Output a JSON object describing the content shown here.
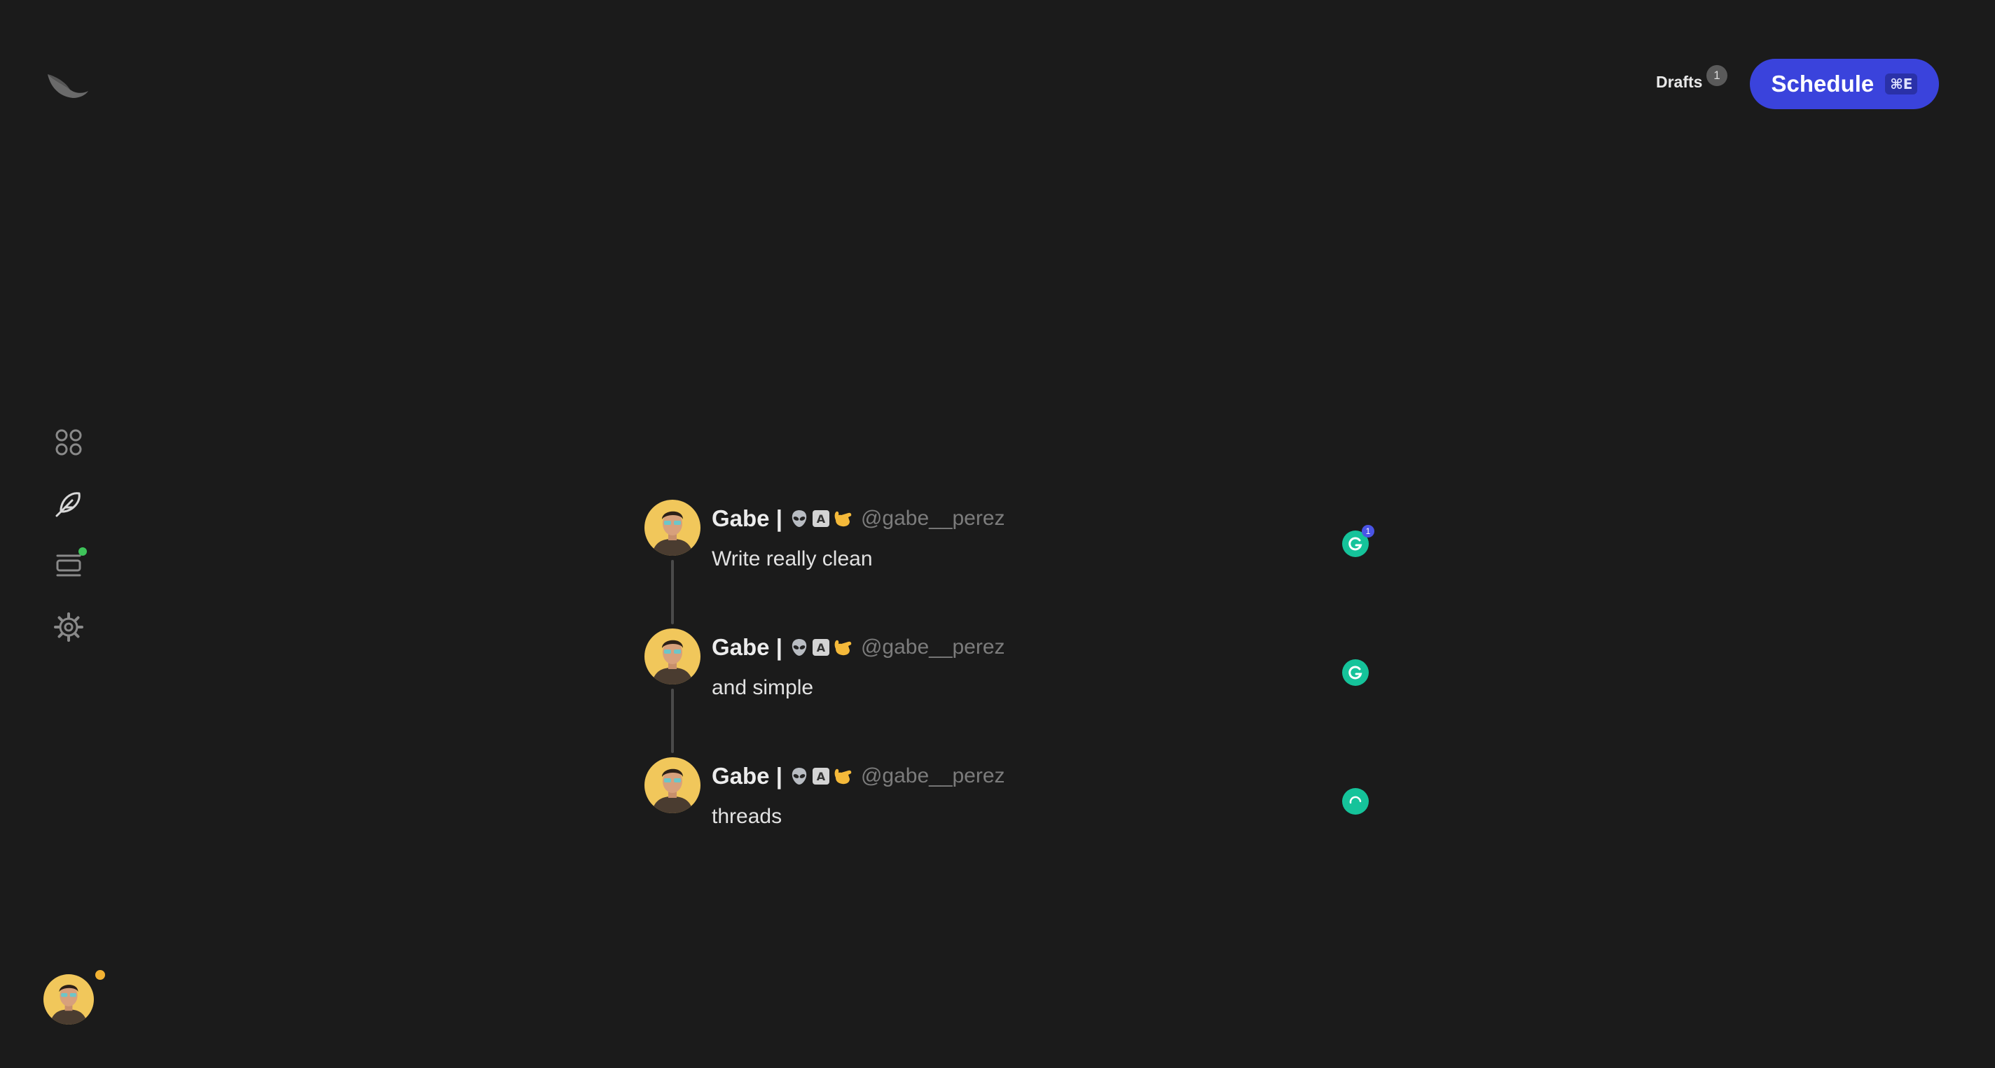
{
  "colors": {
    "background": "#1b1b1b",
    "accent": "#3a43dc",
    "online_dot": "#3ec45a",
    "status_dot": "#f2b233",
    "grammarly": "#15c39a"
  },
  "sidebar": {
    "logo_icon": "bird-wing-icon",
    "items": [
      {
        "id": "dashboard",
        "icon": "grid-icon"
      },
      {
        "id": "compose",
        "icon": "feather-icon"
      },
      {
        "id": "queue",
        "icon": "stack-icon",
        "has_notification": true
      },
      {
        "id": "settings",
        "icon": "gear-icon"
      }
    ],
    "user_avatar_icon": "avatar",
    "user_status": "away"
  },
  "header": {
    "drafts_label": "Drafts",
    "drafts_count": "1",
    "schedule_label": "Schedule",
    "schedule_shortcut": "⌘E"
  },
  "thread": {
    "tweets": [
      {
        "name": "Gabe |",
        "emojis": [
          "alien-icon",
          "a-button-icon",
          "call-me-hand-icon"
        ],
        "handle": "@gabe__perez",
        "text": "Write really clean",
        "grammarly_count": "1",
        "grammarly_state": "ready"
      },
      {
        "name": "Gabe |",
        "emojis": [
          "alien-icon",
          "a-button-icon",
          "call-me-hand-icon"
        ],
        "handle": "@gabe__perez",
        "text": "and simple",
        "grammarly_state": "ready"
      },
      {
        "name": "Gabe |",
        "emojis": [
          "alien-icon",
          "a-button-icon",
          "call-me-hand-icon"
        ],
        "handle": "@gabe__perez",
        "text": "threads",
        "grammarly_state": "loading"
      }
    ]
  }
}
